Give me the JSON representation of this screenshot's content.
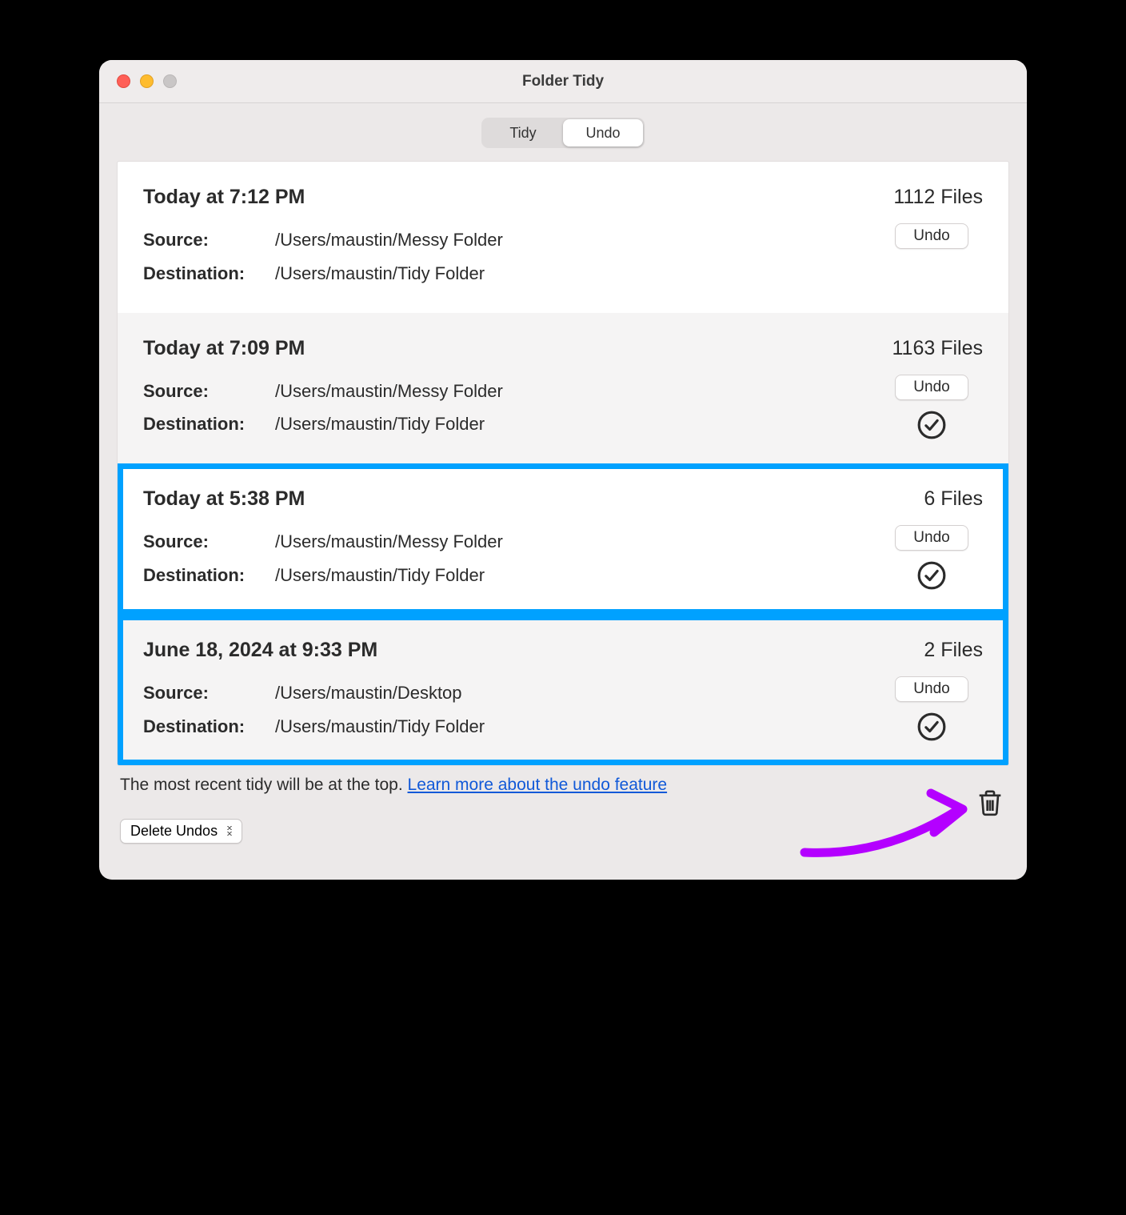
{
  "window": {
    "title": "Folder Tidy"
  },
  "tabs": {
    "tidy": "Tidy",
    "undo": "Undo",
    "active": "undo"
  },
  "entries": [
    {
      "timestamp": "Today at 7:12 PM",
      "filecount": "1112 Files",
      "source_label": "Source:",
      "source_value": "/Users/maustin/Messy Folder",
      "dest_label": "Destination:",
      "dest_value": "/Users/maustin/Tidy Folder",
      "undo_label": "Undo",
      "checked": false,
      "alt": false,
      "selected": false
    },
    {
      "timestamp": "Today at 7:09 PM",
      "filecount": "1163 Files",
      "source_label": "Source:",
      "source_value": "/Users/maustin/Messy Folder",
      "dest_label": "Destination:",
      "dest_value": "/Users/maustin/Tidy Folder",
      "undo_label": "Undo",
      "checked": true,
      "alt": true,
      "selected": false
    },
    {
      "timestamp": "Today at 5:38 PM",
      "filecount": "6 Files",
      "source_label": "Source:",
      "source_value": "/Users/maustin/Messy Folder",
      "dest_label": "Destination:",
      "dest_value": "/Users/maustin/Tidy Folder",
      "undo_label": "Undo",
      "checked": true,
      "alt": false,
      "selected": true
    },
    {
      "timestamp": "June 18, 2024 at 9:33 PM",
      "filecount": "2 Files",
      "source_label": "Source:",
      "source_value": "/Users/maustin/Desktop",
      "dest_label": "Destination:",
      "dest_value": "/Users/maustin/Tidy Folder",
      "undo_label": "Undo",
      "checked": true,
      "alt": true,
      "selected": true
    }
  ],
  "footer": {
    "text": "The most recent tidy will be at the top.  ",
    "link": "Learn more about the undo feature",
    "delete_label": "Delete Undos"
  }
}
